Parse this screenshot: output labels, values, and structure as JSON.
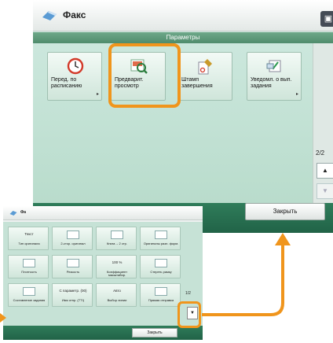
{
  "header": {
    "title": "Факс"
  },
  "panel_title": "Параметры",
  "tiles": [
    {
      "label": "Перед. по расписанию",
      "icon": "clock-icon"
    },
    {
      "label": "Предварит. просмотр",
      "icon": "preview-icon"
    },
    {
      "label": "Штамп завершения",
      "icon": "stamp-icon"
    },
    {
      "label": "Уведомл. о вып. задания",
      "icon": "notify-icon"
    }
  ],
  "page_indicator": "2/2",
  "close_label": "Закрыть",
  "small": {
    "title": "Фа",
    "tiles": [
      {
        "label": "Тип оригинала",
        "face": "Текст"
      },
      {
        "label": "2-стор. оригинал",
        "face": ""
      },
      {
        "label": "Книга→ 2 стр.",
        "face": ""
      },
      {
        "label": "Оригиналы разл. форм.",
        "face": ""
      },
      {
        "label": "Плотность",
        "face": ""
      },
      {
        "label": "Резкость",
        "face": ""
      },
      {
        "label": "Коэффициент масштабир.",
        "face": "100 %"
      },
      {
        "label": "Стереть рамку",
        "face": ""
      },
      {
        "label": "Составление задания",
        "face": ""
      },
      {
        "label": "Имя отпр. (TTI)",
        "face": "С параметр. (00)"
      },
      {
        "label": "Выбор линии",
        "face": "Авто"
      },
      {
        "label": "Прямая отправка",
        "face": ""
      }
    ],
    "page_indicator": "1/2",
    "close_label": "Закрыть"
  },
  "colors": {
    "highlight": "#f0951c",
    "footer": "#216347",
    "panel": "#b9dccc"
  }
}
